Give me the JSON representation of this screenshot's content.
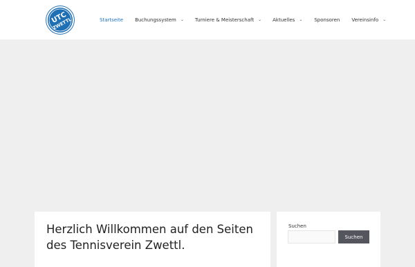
{
  "logo": {
    "text": "UTC ZWETTL",
    "color": "#1f6fb5"
  },
  "nav": {
    "items": [
      {
        "label": "Startseite",
        "active": true,
        "has_dropdown": false
      },
      {
        "label": "Buchungssystem",
        "active": false,
        "has_dropdown": true
      },
      {
        "label": "Turniere & Meisterschaft",
        "active": false,
        "has_dropdown": true
      },
      {
        "label": "Aktuelles",
        "active": false,
        "has_dropdown": true
      },
      {
        "label": "Sponsoren",
        "active": false,
        "has_dropdown": false
      },
      {
        "label": "Vereinsinfo",
        "active": false,
        "has_dropdown": true
      }
    ],
    "chevron": "⌄"
  },
  "main": {
    "title": "Herzlich Willkommen auf den Seiten des Tennisverein Zwettl."
  },
  "sidebar": {
    "search": {
      "label": "Suchen",
      "placeholder": "",
      "value": "",
      "button_label": "Suchen"
    }
  },
  "colors": {
    "accent": "#1e73be",
    "page_background": "#efefef",
    "button_background": "#55555e"
  }
}
